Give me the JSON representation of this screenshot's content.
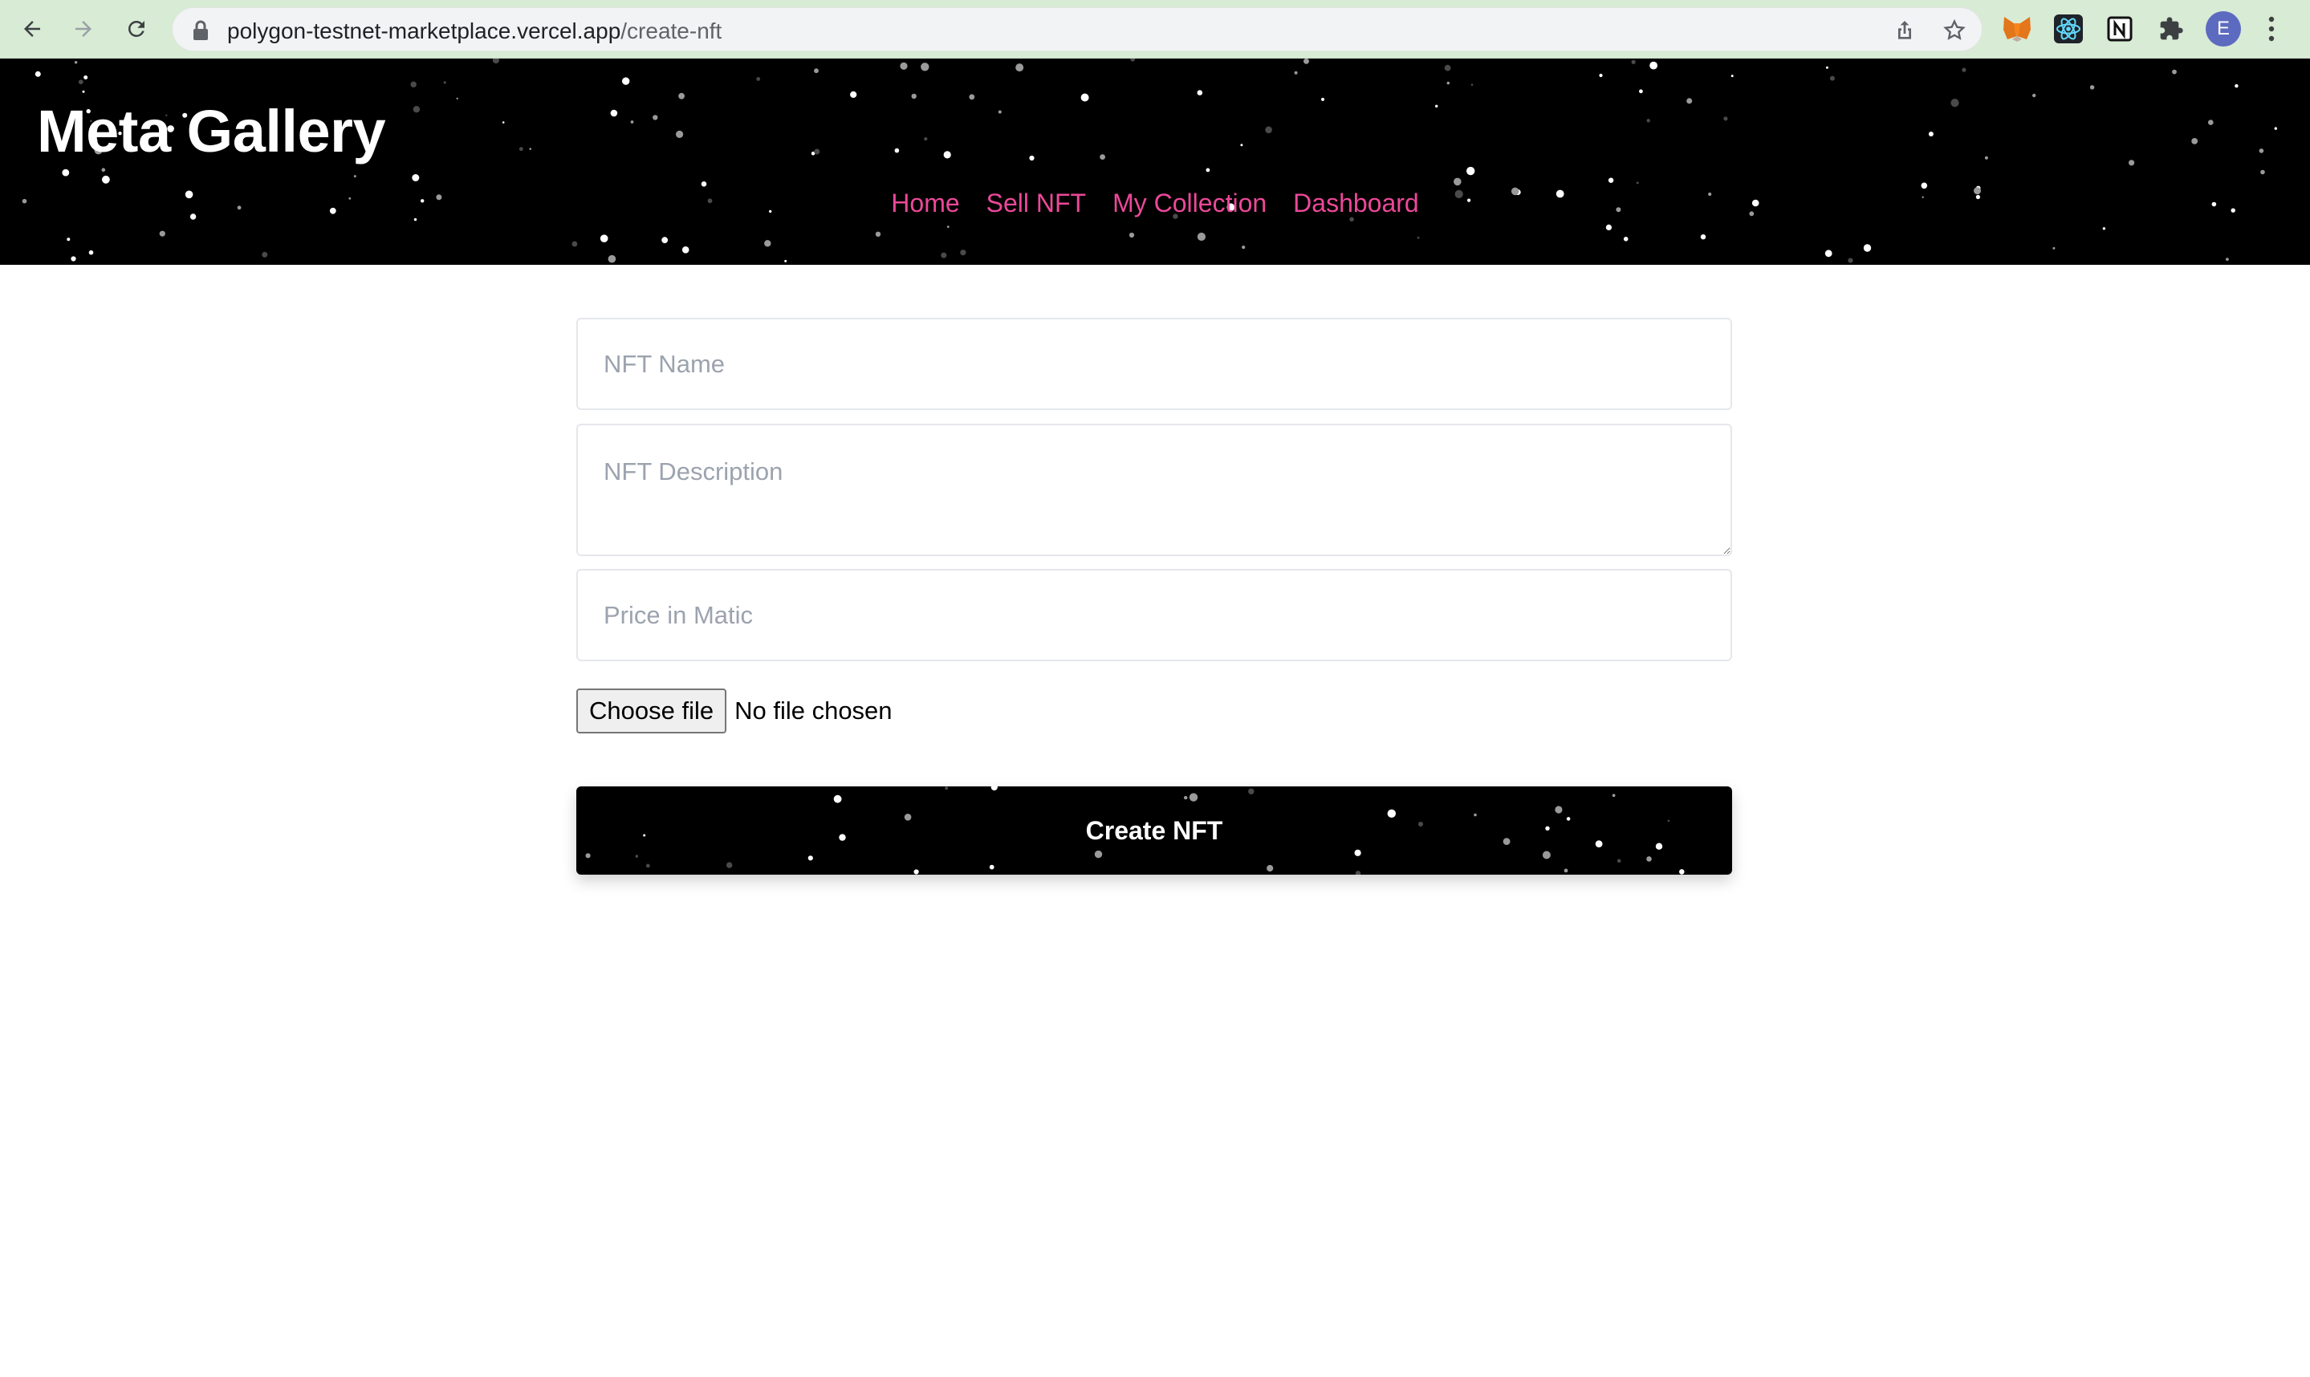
{
  "browser": {
    "url_domain": "polygon-testnet-marketplace.vercel.app",
    "url_path": "/create-nft",
    "avatar_letter": "E"
  },
  "header": {
    "title": "Meta Gallery",
    "nav": [
      "Home",
      "Sell NFT",
      "My Collection",
      "Dashboard"
    ],
    "nav_color": "#ec4899"
  },
  "form": {
    "name_placeholder": "NFT Name",
    "description_placeholder": "NFT Description",
    "price_placeholder": "Price in Matic",
    "file_button": "Choose file",
    "file_status": "No file chosen",
    "submit_label": "Create NFT"
  }
}
